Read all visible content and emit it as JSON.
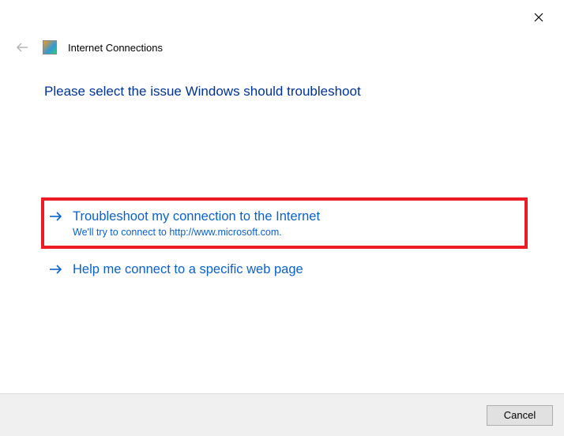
{
  "window": {
    "title": "Internet Connections"
  },
  "heading": "Please select the issue Windows should troubleshoot",
  "options": [
    {
      "title": "Troubleshoot my connection to the Internet",
      "desc": "We'll try to connect to http://www.microsoft.com."
    },
    {
      "title": "Help me connect to a specific web page",
      "desc": ""
    }
  ],
  "footer": {
    "cancel": "Cancel"
  }
}
